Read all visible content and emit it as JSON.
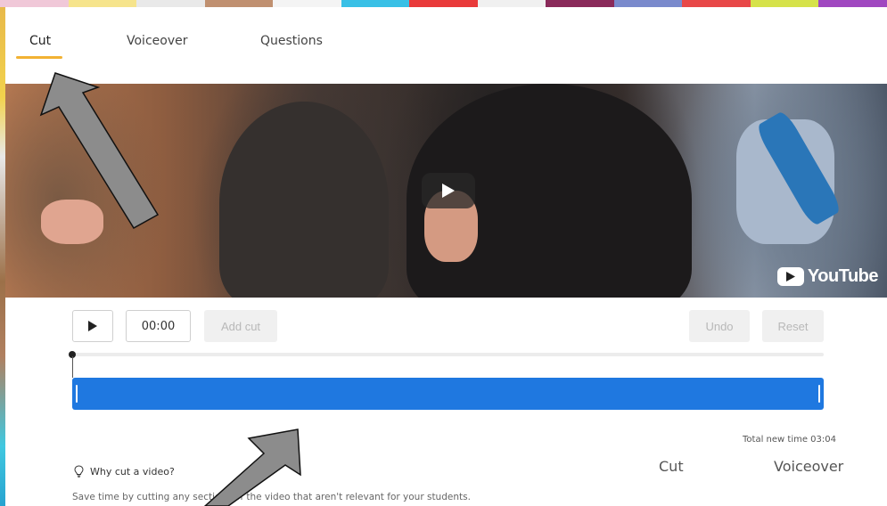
{
  "tabs": [
    {
      "label": "Cut",
      "active": true
    },
    {
      "label": "Voiceover",
      "active": false
    },
    {
      "label": "Questions",
      "active": false
    }
  ],
  "video": {
    "provider_logo": "YouTube",
    "play_icon": "play-icon"
  },
  "controls": {
    "play_icon": "play-icon",
    "time": "00:00",
    "add_cut_label": "Add cut",
    "undo_label": "Undo",
    "reset_label": "Reset"
  },
  "timeline": {
    "total_time": "Total new time 03:04"
  },
  "info": {
    "heading": "Why cut a video?",
    "icon": "lightbulb-icon",
    "description": "Save time by cutting any sections of the video that aren't relevant for your students."
  },
  "mini_tabs": [
    {
      "label": "Cut"
    },
    {
      "label": "Voiceover"
    }
  ],
  "colors": {
    "accent": "#f2b233",
    "clip": "#1f78e0",
    "arrow_fill": "#8c8c8c"
  }
}
